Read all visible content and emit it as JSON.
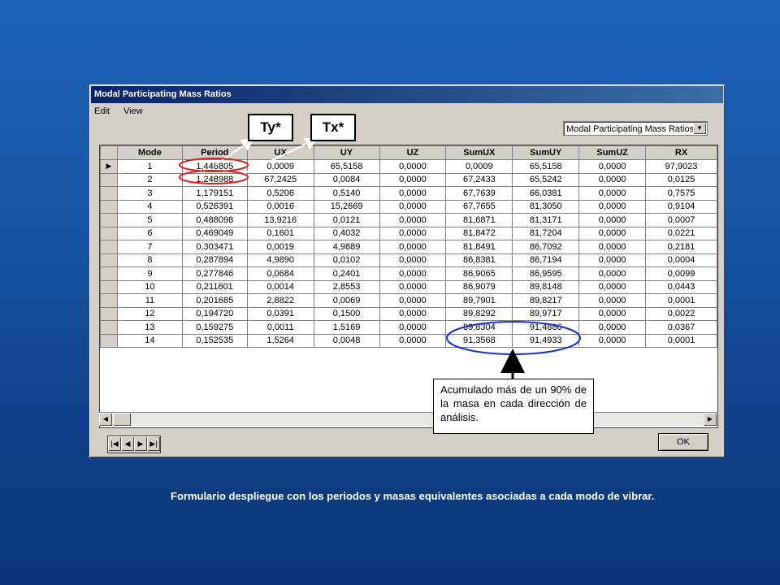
{
  "window": {
    "title": "Modal Participating Mass Ratios",
    "menu": [
      "Edit",
      "View"
    ],
    "combo_value": "Modal Participating Mass Ratios",
    "ok_label": "OK"
  },
  "table": {
    "columns": [
      "Mode",
      "Period",
      "UX",
      "UY",
      "UZ",
      "SumUX",
      "SumUY",
      "SumUZ",
      "RX"
    ],
    "rows": [
      [
        "1",
        "1,448805",
        "0,0009",
        "65,5158",
        "0,0000",
        "0,0009",
        "65,5158",
        "0,0000",
        "97,9023"
      ],
      [
        "2",
        "1,248988",
        "67,2425",
        "0,0084",
        "0,0000",
        "67,2433",
        "65,5242",
        "0,0000",
        "0,0125"
      ],
      [
        "3",
        "1,179151",
        "0,5206",
        "0,5140",
        "0,0000",
        "67,7639",
        "66,0381",
        "0,0000",
        "0,7575"
      ],
      [
        "4",
        "0,526391",
        "0,0016",
        "15,2669",
        "0,0000",
        "67,7655",
        "81,3050",
        "0,0000",
        "0,9104"
      ],
      [
        "5",
        "0,488098",
        "13,9216",
        "0,0121",
        "0,0000",
        "81,6871",
        "81,3171",
        "0,0000",
        "0,0007"
      ],
      [
        "6",
        "0,469049",
        "0,1601",
        "0,4032",
        "0,0000",
        "81,8472",
        "81,7204",
        "0,0000",
        "0,0221"
      ],
      [
        "7",
        "0,303471",
        "0,0019",
        "4,9889",
        "0,0000",
        "81,8491",
        "86,7092",
        "0,0000",
        "0,2181"
      ],
      [
        "8",
        "0,287894",
        "4,9890",
        "0,0102",
        "0,0000",
        "86,8381",
        "86,7194",
        "0,0000",
        "0,0004"
      ],
      [
        "9",
        "0,277846",
        "0,0684",
        "0,2401",
        "0,0000",
        "86,9065",
        "86,9595",
        "0,0000",
        "0,0099"
      ],
      [
        "10",
        "0,211601",
        "0,0014",
        "2,8553",
        "0,0000",
        "86,9079",
        "89,8148",
        "0,0000",
        "0,0443"
      ],
      [
        "11",
        "0,201685",
        "2,8822",
        "0,0069",
        "0,0000",
        "89,7901",
        "89,8217",
        "0,0000",
        "0,0001"
      ],
      [
        "12",
        "0,194720",
        "0,0391",
        "0,1500",
        "0,0000",
        "89,8292",
        "89,9717",
        "0,0000",
        "0,0022"
      ],
      [
        "13",
        "0,159275",
        "0,0011",
        "1,5169",
        "0,0000",
        "89,8304",
        "91,4886",
        "0,0000",
        "0,0367"
      ],
      [
        "14",
        "0,152535",
        "1,5264",
        "0,0048",
        "0,0000",
        "91,3568",
        "91,4933",
        "0,0000",
        "0,0001"
      ]
    ]
  },
  "annotations": {
    "ty_label": "Ty*",
    "tx_label": "Tx*",
    "callout_text": "Acumulado más de un 90% de la masa en cada dirección de análisis.",
    "ellipse_color": "#e0201c",
    "circle_color": "#1c2fd0"
  },
  "caption": "Formulario despliegue con los periodos y masas equivalentes asociadas a cada modo de vibrar."
}
